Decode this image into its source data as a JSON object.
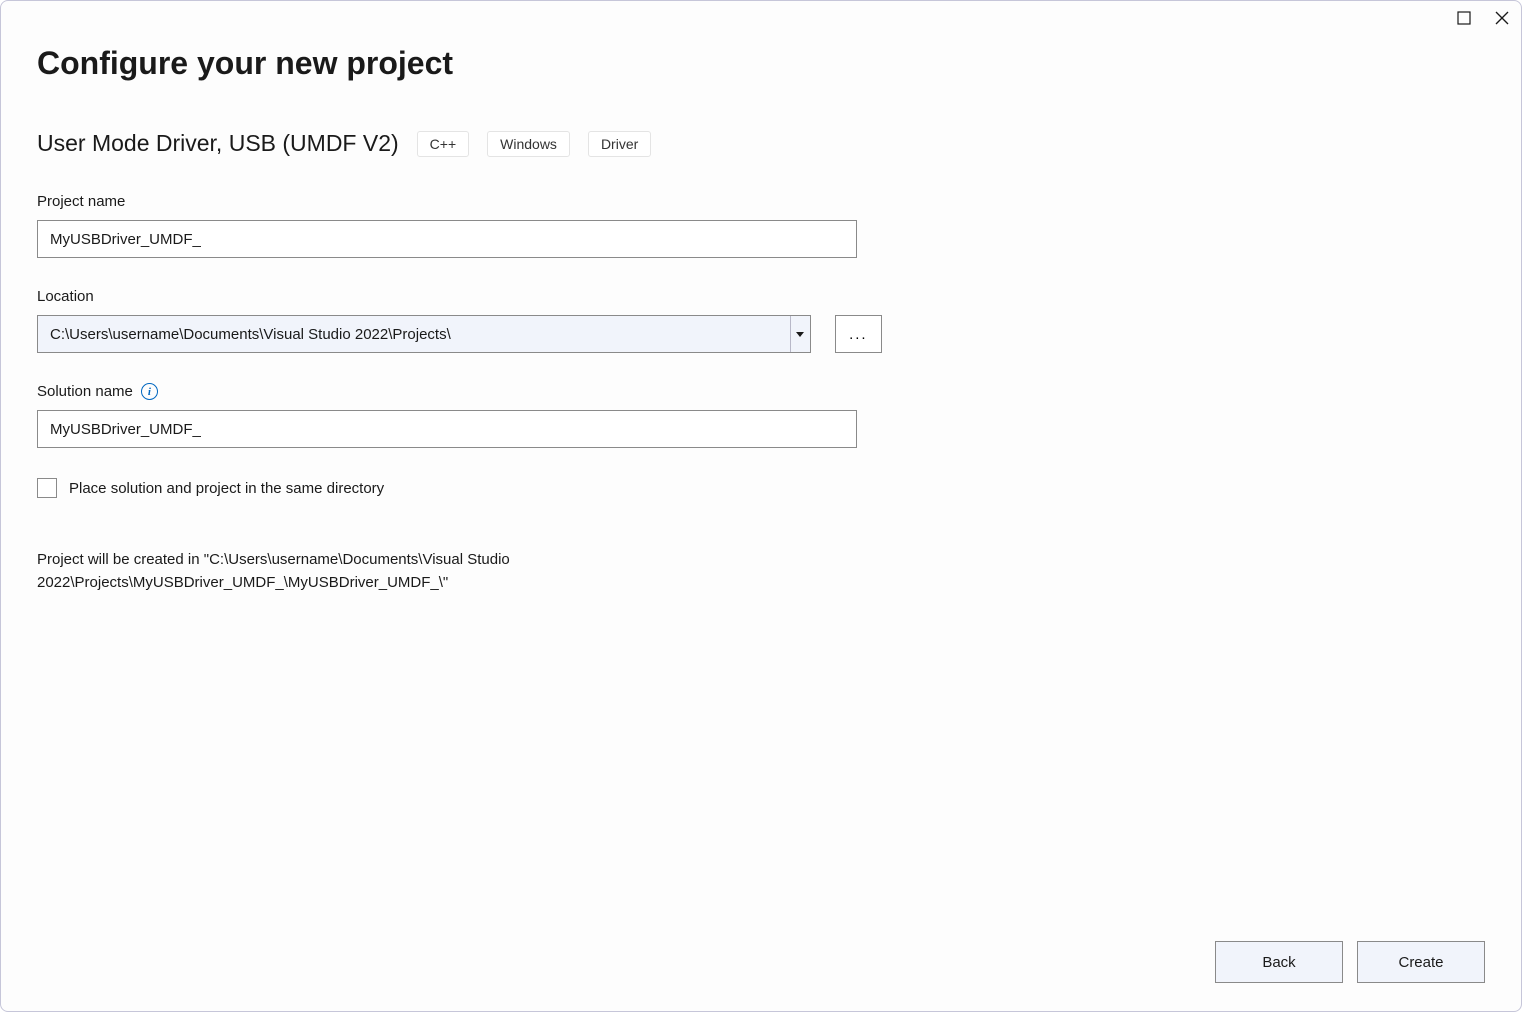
{
  "header": {
    "title": "Configure your new project"
  },
  "template": {
    "name": "User Mode Driver, USB (UMDF V2)",
    "tags": [
      "C++",
      "Windows",
      "Driver"
    ]
  },
  "fields": {
    "project_name": {
      "label": "Project name",
      "value": "MyUSBDriver_UMDF_"
    },
    "location": {
      "label": "Location",
      "value": "C:\\Users\\username\\Documents\\Visual Studio 2022\\Projects\\",
      "browse_label": "..."
    },
    "solution_name": {
      "label": "Solution name",
      "value": "MyUSBDriver_UMDF_"
    },
    "same_dir": {
      "label": "Place solution and project in the same directory",
      "checked": false
    }
  },
  "path_preview": "Project will be created in \"C:\\Users\\username\\Documents\\Visual Studio 2022\\Projects\\MyUSBDriver_UMDF_\\MyUSBDriver_UMDF_\\\"",
  "footer": {
    "back_label": "Back",
    "create_label": "Create"
  },
  "icons": {
    "info": "i"
  }
}
